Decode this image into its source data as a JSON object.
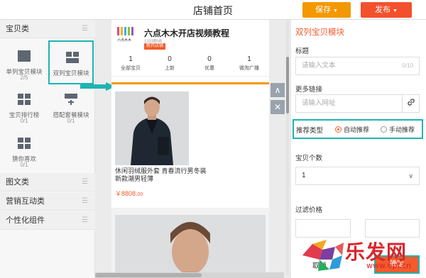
{
  "topbar": {
    "title": "店铺首页",
    "save_label": "保存",
    "publish_label": "发布",
    "save_color": "#f39800",
    "publish_color": "#f2512c"
  },
  "left_panel": {
    "sections": [
      {
        "title": "宝贝类"
      },
      {
        "title": "图文类"
      },
      {
        "title": "营销互动类"
      },
      {
        "title": "个性化组件"
      }
    ],
    "modules": [
      {
        "label": "单列宝贝模块",
        "count": "2/5",
        "icon": "single-column-icon"
      },
      {
        "label": "双列宝贝模块",
        "count": "",
        "icon": "two-column-icon",
        "active": true
      },
      {
        "label": "宝贝排行榜",
        "count": "0/1",
        "icon": "ranking-grid-icon"
      },
      {
        "label": "搭配套餐模块",
        "count": "0/1",
        "icon": "combo-package-icon"
      },
      {
        "label": "猜你喜欢",
        "count": "0/1",
        "icon": "guess-you-like-icon"
      }
    ]
  },
  "preview": {
    "shop": {
      "name": "六点木木开店视频教程",
      "fans": "1333粉丝",
      "badge": "新开店铺",
      "logo_text": "六点木木"
    },
    "stats": [
      {
        "num": "1",
        "label": "全部宝贝"
      },
      {
        "num": "0",
        "label": "上新"
      },
      {
        "num": "0",
        "label": "优惠"
      },
      {
        "num": "1",
        "label": "微淘广播"
      }
    ],
    "product": {
      "title": "休闲羽绒服外套 青春流行男冬装新款潮男轻薄",
      "price_main": "￥8808.",
      "price_cents": "00"
    }
  },
  "right_panel": {
    "title": "双列宝贝模块",
    "title_label": "标题",
    "title_placeholder": "请输入文本",
    "title_counter": "0/10",
    "more_link_label": "更多链接",
    "more_link_placeholder": "请输入网址",
    "rec_type_label": "推荐类型",
    "rec_auto": "自动推荐",
    "rec_manual": "手动推荐",
    "count_label": "宝贝个数",
    "count_value": "1",
    "price_filter_label": "过滤价格",
    "cancel_label": "取消",
    "ok_label": "确定",
    "accent_color": "#f25b2c",
    "highlight_color": "#1fb3b3"
  },
  "watermark": {
    "text": "乐发网",
    "url": "www.6pf.cn"
  }
}
